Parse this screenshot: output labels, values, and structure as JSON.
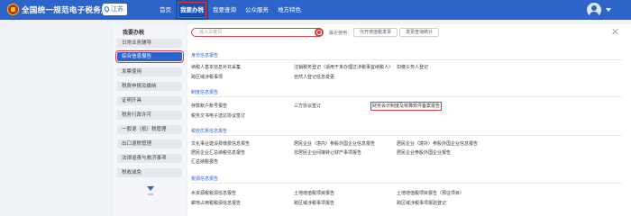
{
  "header": {
    "site_title": "全国统一规范电子税务局",
    "region": "江苏",
    "nav": [
      "首页",
      "我要办税",
      "我要查询",
      "公众服务",
      "地方特色"
    ],
    "active_nav": 1
  },
  "sidebar": {
    "title": "我要办税",
    "items": [
      "综合信息报告",
      "发票使用",
      "税费申报及缴纳",
      "证明开具",
      "税务行政许可",
      "一般退（抵）税管理",
      "出口退税管理",
      "法律追责与救济事项",
      "税收减免"
    ],
    "extra_top": "日常业务辅导",
    "active_index": 0
  },
  "search": {
    "placeholder": "输入关键词",
    "recent_label": "最近使用：",
    "recent": [
      "代开增值税发票",
      "发票查询统计"
    ]
  },
  "sections": [
    {
      "title": "身份信息报告",
      "rows": [
        [
          "纳税人基本信息补充采集",
          "注销税务登记（适用于未办理过涉税事宜纳税人）",
          "扣缴义务人登记"
        ],
        [
          "跨区域涉税事项",
          "自然人登记信息变更",
          ""
        ]
      ]
    },
    {
      "title": "制度信息报告",
      "rows": [
        [
          "存款账户账号报告",
          "三方协议签订",
          "财务会计制度及核算软件备案报告"
        ],
        [
          "税务文书电子送达协议签订",
          "",
          ""
        ]
      ]
    },
    {
      "title": "税收优惠信息报告",
      "rows": [
        [
          "文化事业建设费缴费信息报告",
          "居民企业（境内）参股外国企业信息报告",
          "居民企业（境外）参股外国企业信息报告"
        ],
        [
          "居民企业汇总纳税信息报告",
          "非居民企业间接转让财产事项报告",
          "居民企业参股外国企业报告"
        ],
        [
          "汇总纳税报告",
          "",
          ""
        ]
      ]
    },
    {
      "title": "税源信息报告",
      "rows": [
        [
          "水资源税税源信息报告",
          "土地增值税项目报告",
          "土地增值税项目报告（预征项目）"
        ],
        [
          "耕地占用税税源信息报告",
          "跨区域涉税事项报告",
          "跨区域涉税事项报验登记"
        ]
      ]
    }
  ],
  "highlight_link": "财务会计制度及核算软件备案报告"
}
